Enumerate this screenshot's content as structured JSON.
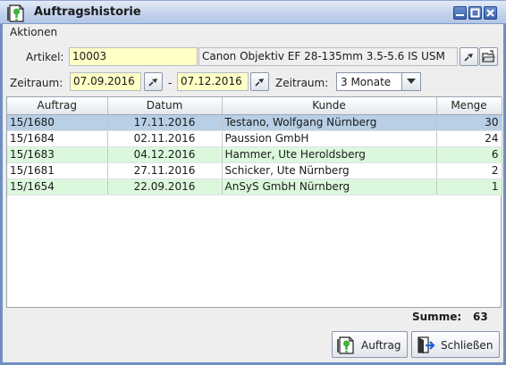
{
  "window": {
    "title": "Auftragshistorie",
    "icon": "help-document-icon"
  },
  "menu": {
    "items": [
      "Aktionen"
    ]
  },
  "filter": {
    "artikel_label": "Artikel:",
    "artikel_value": "10003",
    "artikel_description": "Canon Objektiv EF 28-135mm 3.5-5.6 IS USM",
    "zeitraum_label": "Zeitraum:",
    "date_from": "07.09.2016",
    "date_separator": "-",
    "date_to": "07.12.2016",
    "zeitraum_select_label": "Zeitraum:",
    "zeitraum_selected": "3 Monate"
  },
  "table": {
    "columns": [
      "Auftrag",
      "Datum",
      "Kunde",
      "Menge"
    ],
    "rows": [
      {
        "auftrag": "15/1680",
        "datum": "17.11.2016",
        "kunde": "Testano, Wolfgang Nürnberg",
        "menge": "30",
        "style": "selected"
      },
      {
        "auftrag": "15/1684",
        "datum": "02.11.2016",
        "kunde": "Paussion GmbH",
        "menge": "24",
        "style": "white"
      },
      {
        "auftrag": "15/1683",
        "datum": "04.12.2016",
        "kunde": "Hammer, Ute Heroldsberg",
        "menge": "6",
        "style": "green"
      },
      {
        "auftrag": "15/1681",
        "datum": "27.11.2016",
        "kunde": "Schicker, Ute Nürnberg",
        "menge": "2",
        "style": "white"
      },
      {
        "auftrag": "15/1654",
        "datum": "22.09.2016",
        "kunde": "AnSyS GmbH Nürnberg",
        "menge": "1",
        "style": "green"
      }
    ]
  },
  "summary": {
    "label": "Summe:",
    "value": "63"
  },
  "buttons": {
    "auftrag": "Auftrag",
    "schliessen": "Schließen"
  },
  "colors": {
    "title_bar": "#c3d3ec",
    "selected_row": "#b8cfe5",
    "green_row": "#dcf8dc",
    "input_yellow": "#ffffc6"
  }
}
